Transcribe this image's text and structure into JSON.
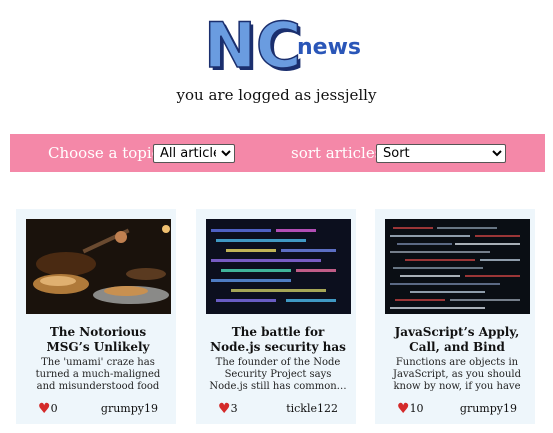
{
  "header": {
    "logo_letters": "NC",
    "logo_word": "news",
    "logged_in_text": "you are logged as jessjelly"
  },
  "controls": {
    "topic_label": "Choose a topic",
    "topic_selected": "All articles",
    "sort_label": "sort articles",
    "sort_selected": "Sort"
  },
  "articles": [
    {
      "title": "The Notorious MSG’s Unlikely Formula For…",
      "description": "The 'umami' craze has turned a much-maligned and misunderstood food additive…",
      "votes": "0",
      "author": "grumpy19",
      "image_icon": "food-photo"
    },
    {
      "title": "The battle for Node.js security has only begun",
      "description": "The founder of the Node Security Project says Node.js still has common…",
      "votes": "3",
      "author": "tickle122",
      "image_icon": "code-screen-photo"
    },
    {
      "title": "JavaScript’s Apply, Call, and Bind Methods are…",
      "description": "Functions are objects in JavaScript, as you should know by now, if you have read any…",
      "votes": "10",
      "author": "grumpy19",
      "image_icon": "code-screen-photo"
    }
  ],
  "colors": {
    "bar_background": "#f488a8",
    "card_background": "#eef6fb",
    "logo_blue": "#5b8fd6",
    "heart": "#d42a2a"
  }
}
